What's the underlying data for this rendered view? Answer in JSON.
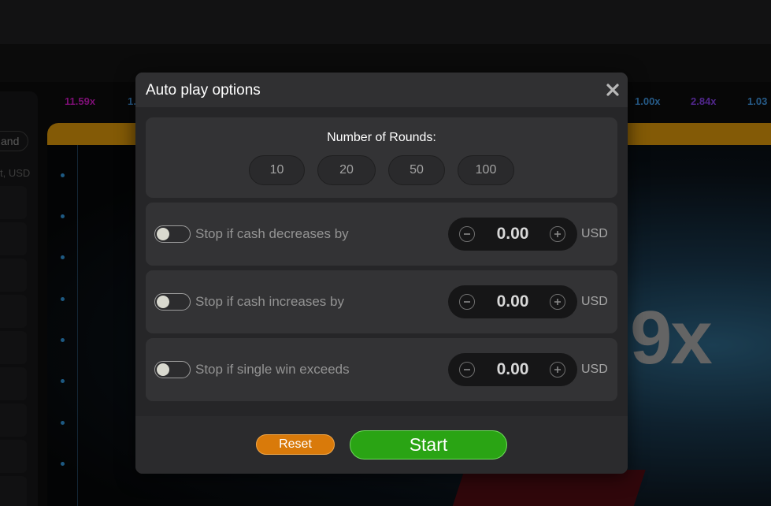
{
  "background": {
    "multiplier_history": [
      {
        "value": "11.59x",
        "color": "#c017b4"
      },
      {
        "value": "1.",
        "color": "#3b8bd0"
      },
      {
        "value": "1.00x",
        "color": "#3b8bd0"
      },
      {
        "value": "2.84x",
        "color": "#7c3bd6"
      },
      {
        "value": "1.03",
        "color": "#3b8bd0"
      }
    ],
    "left_panel": {
      "pill_label": "and",
      "usd_label": "t, USD"
    },
    "big_multiplier": "9x"
  },
  "modal": {
    "title": "Auto play options",
    "close_icon": "close-icon",
    "rounds": {
      "label": "Number of Rounds:",
      "options": [
        "10",
        "20",
        "50",
        "100"
      ]
    },
    "stop_conditions": [
      {
        "label": "Stop if cash decreases by",
        "value": "0.00",
        "currency": "USD",
        "enabled": false
      },
      {
        "label": "Stop if cash increases by",
        "value": "0.00",
        "currency": "USD",
        "enabled": false
      },
      {
        "label": "Stop if single win exceeds",
        "value": "0.00",
        "currency": "USD",
        "enabled": false
      }
    ],
    "footer": {
      "reset_label": "Reset",
      "start_label": "Start"
    }
  },
  "colors": {
    "accent_orange": "#d97a0a",
    "accent_green": "#2aa414",
    "modal_bg": "#262628"
  }
}
